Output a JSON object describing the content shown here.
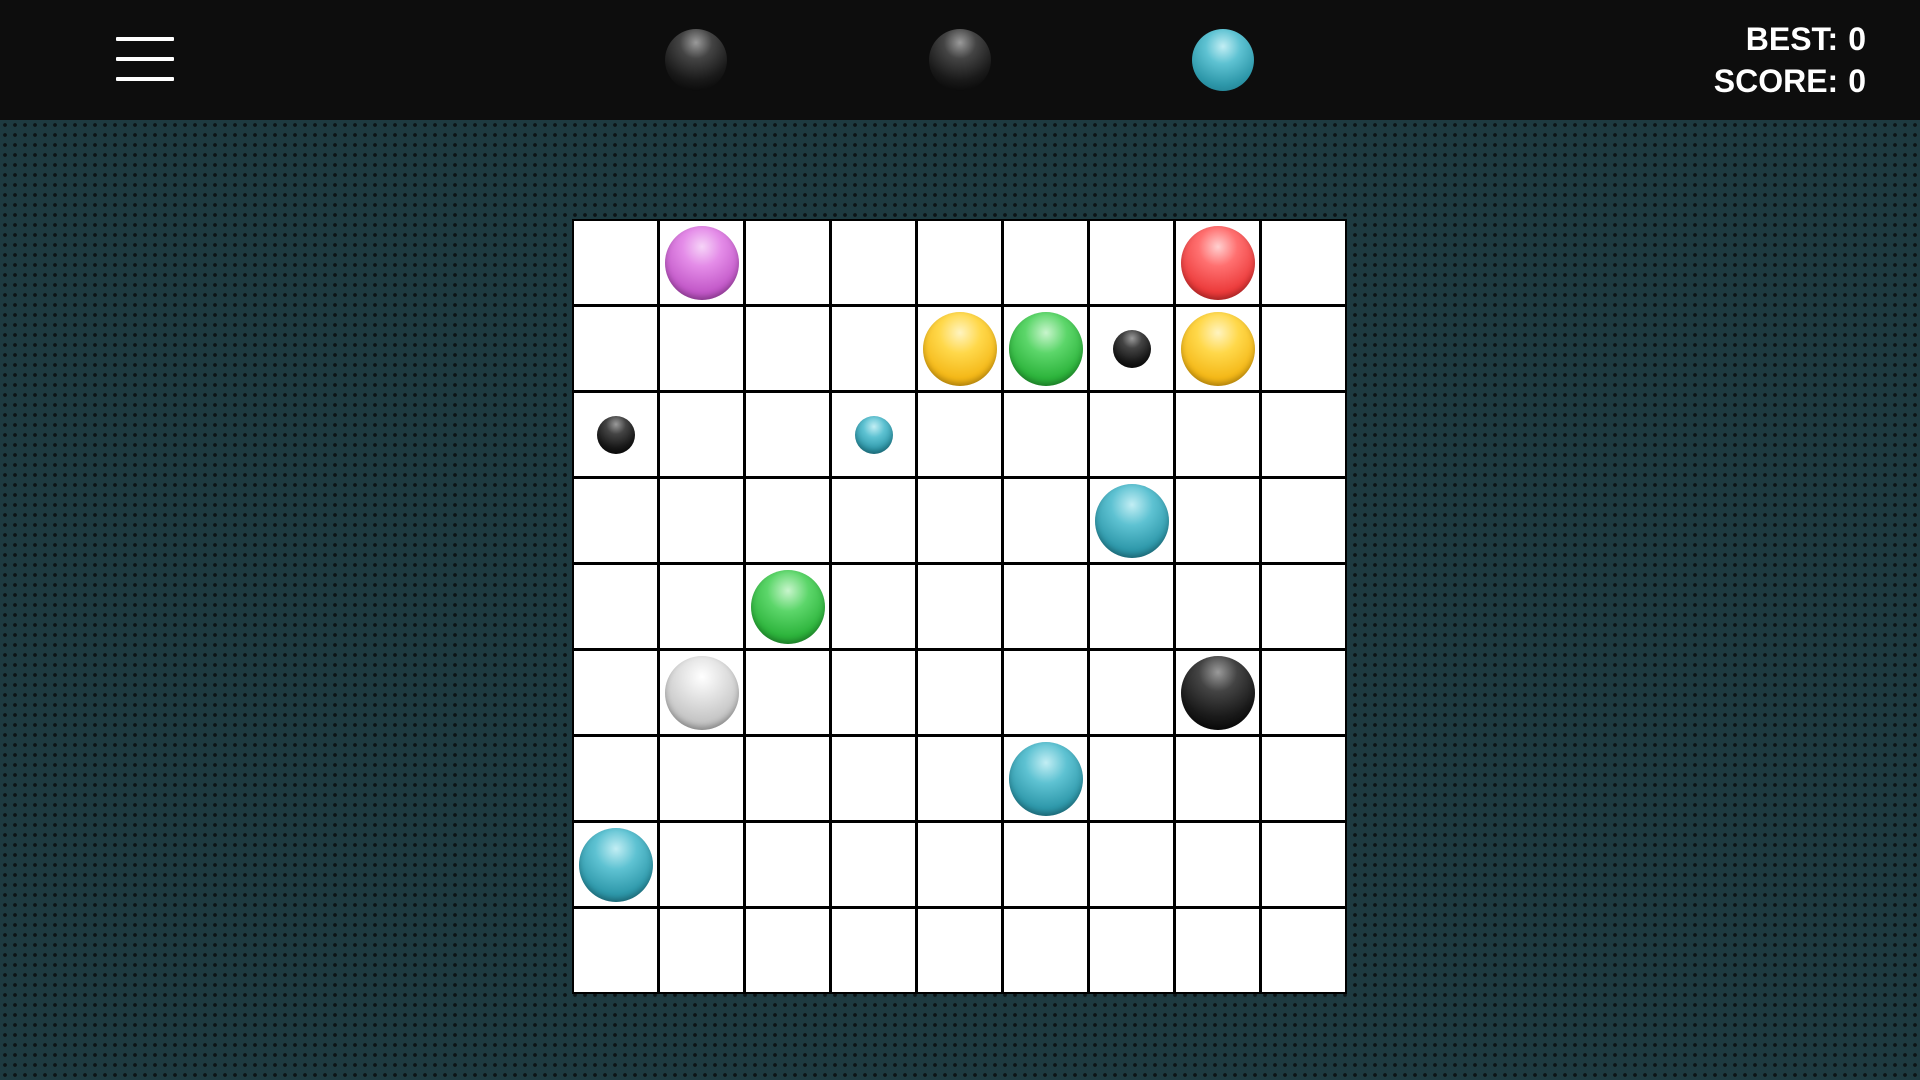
{
  "header": {
    "best_label": "BEST:",
    "best_value": "0",
    "score_label": "SCORE:",
    "score_value": "0",
    "menu_icon": "hamburger-menu-icon"
  },
  "next_balls": [
    "black",
    "black",
    "teal"
  ],
  "board": {
    "rows": 9,
    "cols": 9,
    "balls": [
      {
        "row": 0,
        "col": 1,
        "color": "purple",
        "size": "big"
      },
      {
        "row": 0,
        "col": 7,
        "color": "red",
        "size": "big"
      },
      {
        "row": 1,
        "col": 4,
        "color": "yellow",
        "size": "big"
      },
      {
        "row": 1,
        "col": 5,
        "color": "green",
        "size": "big"
      },
      {
        "row": 1,
        "col": 6,
        "color": "black",
        "size": "small"
      },
      {
        "row": 1,
        "col": 7,
        "color": "yellow",
        "size": "big"
      },
      {
        "row": 2,
        "col": 0,
        "color": "black",
        "size": "small"
      },
      {
        "row": 2,
        "col": 3,
        "color": "teal",
        "size": "small"
      },
      {
        "row": 3,
        "col": 6,
        "color": "teal",
        "size": "big"
      },
      {
        "row": 4,
        "col": 2,
        "color": "green",
        "size": "big"
      },
      {
        "row": 5,
        "col": 1,
        "color": "silver",
        "size": "big"
      },
      {
        "row": 5,
        "col": 7,
        "color": "black",
        "size": "big"
      },
      {
        "row": 6,
        "col": 5,
        "color": "teal",
        "size": "big"
      },
      {
        "row": 7,
        "col": 0,
        "color": "teal",
        "size": "big"
      }
    ]
  },
  "colors": {
    "background": "#1e3a40",
    "topbar": "#0d0d0d",
    "grid_line": "#000000",
    "cell": "#ffffff"
  }
}
